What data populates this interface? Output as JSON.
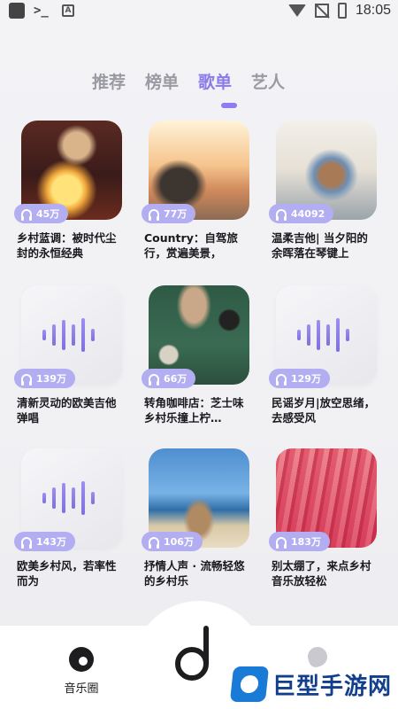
{
  "status_bar": {
    "time": "18:05"
  },
  "tabs": [
    {
      "label": "推荐",
      "active": false
    },
    {
      "label": "榜单",
      "active": false
    },
    {
      "label": "歌单",
      "active": true
    },
    {
      "label": "艺人",
      "active": false
    }
  ],
  "colors": {
    "accent": "#8b7be8",
    "badge": "#b3adf2",
    "tab_inactive": "#9a9aa3"
  },
  "playlists": [
    {
      "title": "乡村蓝调：被时代尘封的永恒经典",
      "plays": "45万",
      "cover": "photo-lantern"
    },
    {
      "title": "Country：自驾旅行，赏遍美景，",
      "plays": "77万",
      "cover": "photo-roadtrip"
    },
    {
      "title": "温柔吉他| 当夕阳的余晖落在琴键上",
      "plays": "44092",
      "cover": "photo-guitar"
    },
    {
      "title": "清新灵动的欧美吉他弹唱",
      "plays": "139万",
      "cover": "placeholder-wave"
    },
    {
      "title": "转角咖啡店：芝士味乡村乐撞上柠…",
      "plays": "66万",
      "cover": "photo-cafe"
    },
    {
      "title": "民谣岁月|放空思绪，去感受风",
      "plays": "129万",
      "cover": "placeholder-wave"
    },
    {
      "title": "欧美乡村风，若率性而为",
      "plays": "143万",
      "cover": "placeholder-wave"
    },
    {
      "title": "抒情人声 · 流畅轻悠的乡村乐",
      "plays": "106万",
      "cover": "photo-beach"
    },
    {
      "title": "别太绷了，来点乡村音乐放轻松",
      "plays": "183万",
      "cover": "photo-flamingo"
    }
  ],
  "bottom_nav": {
    "music_circle_label": "音乐圈"
  },
  "watermark": {
    "text": "巨型手游网"
  }
}
